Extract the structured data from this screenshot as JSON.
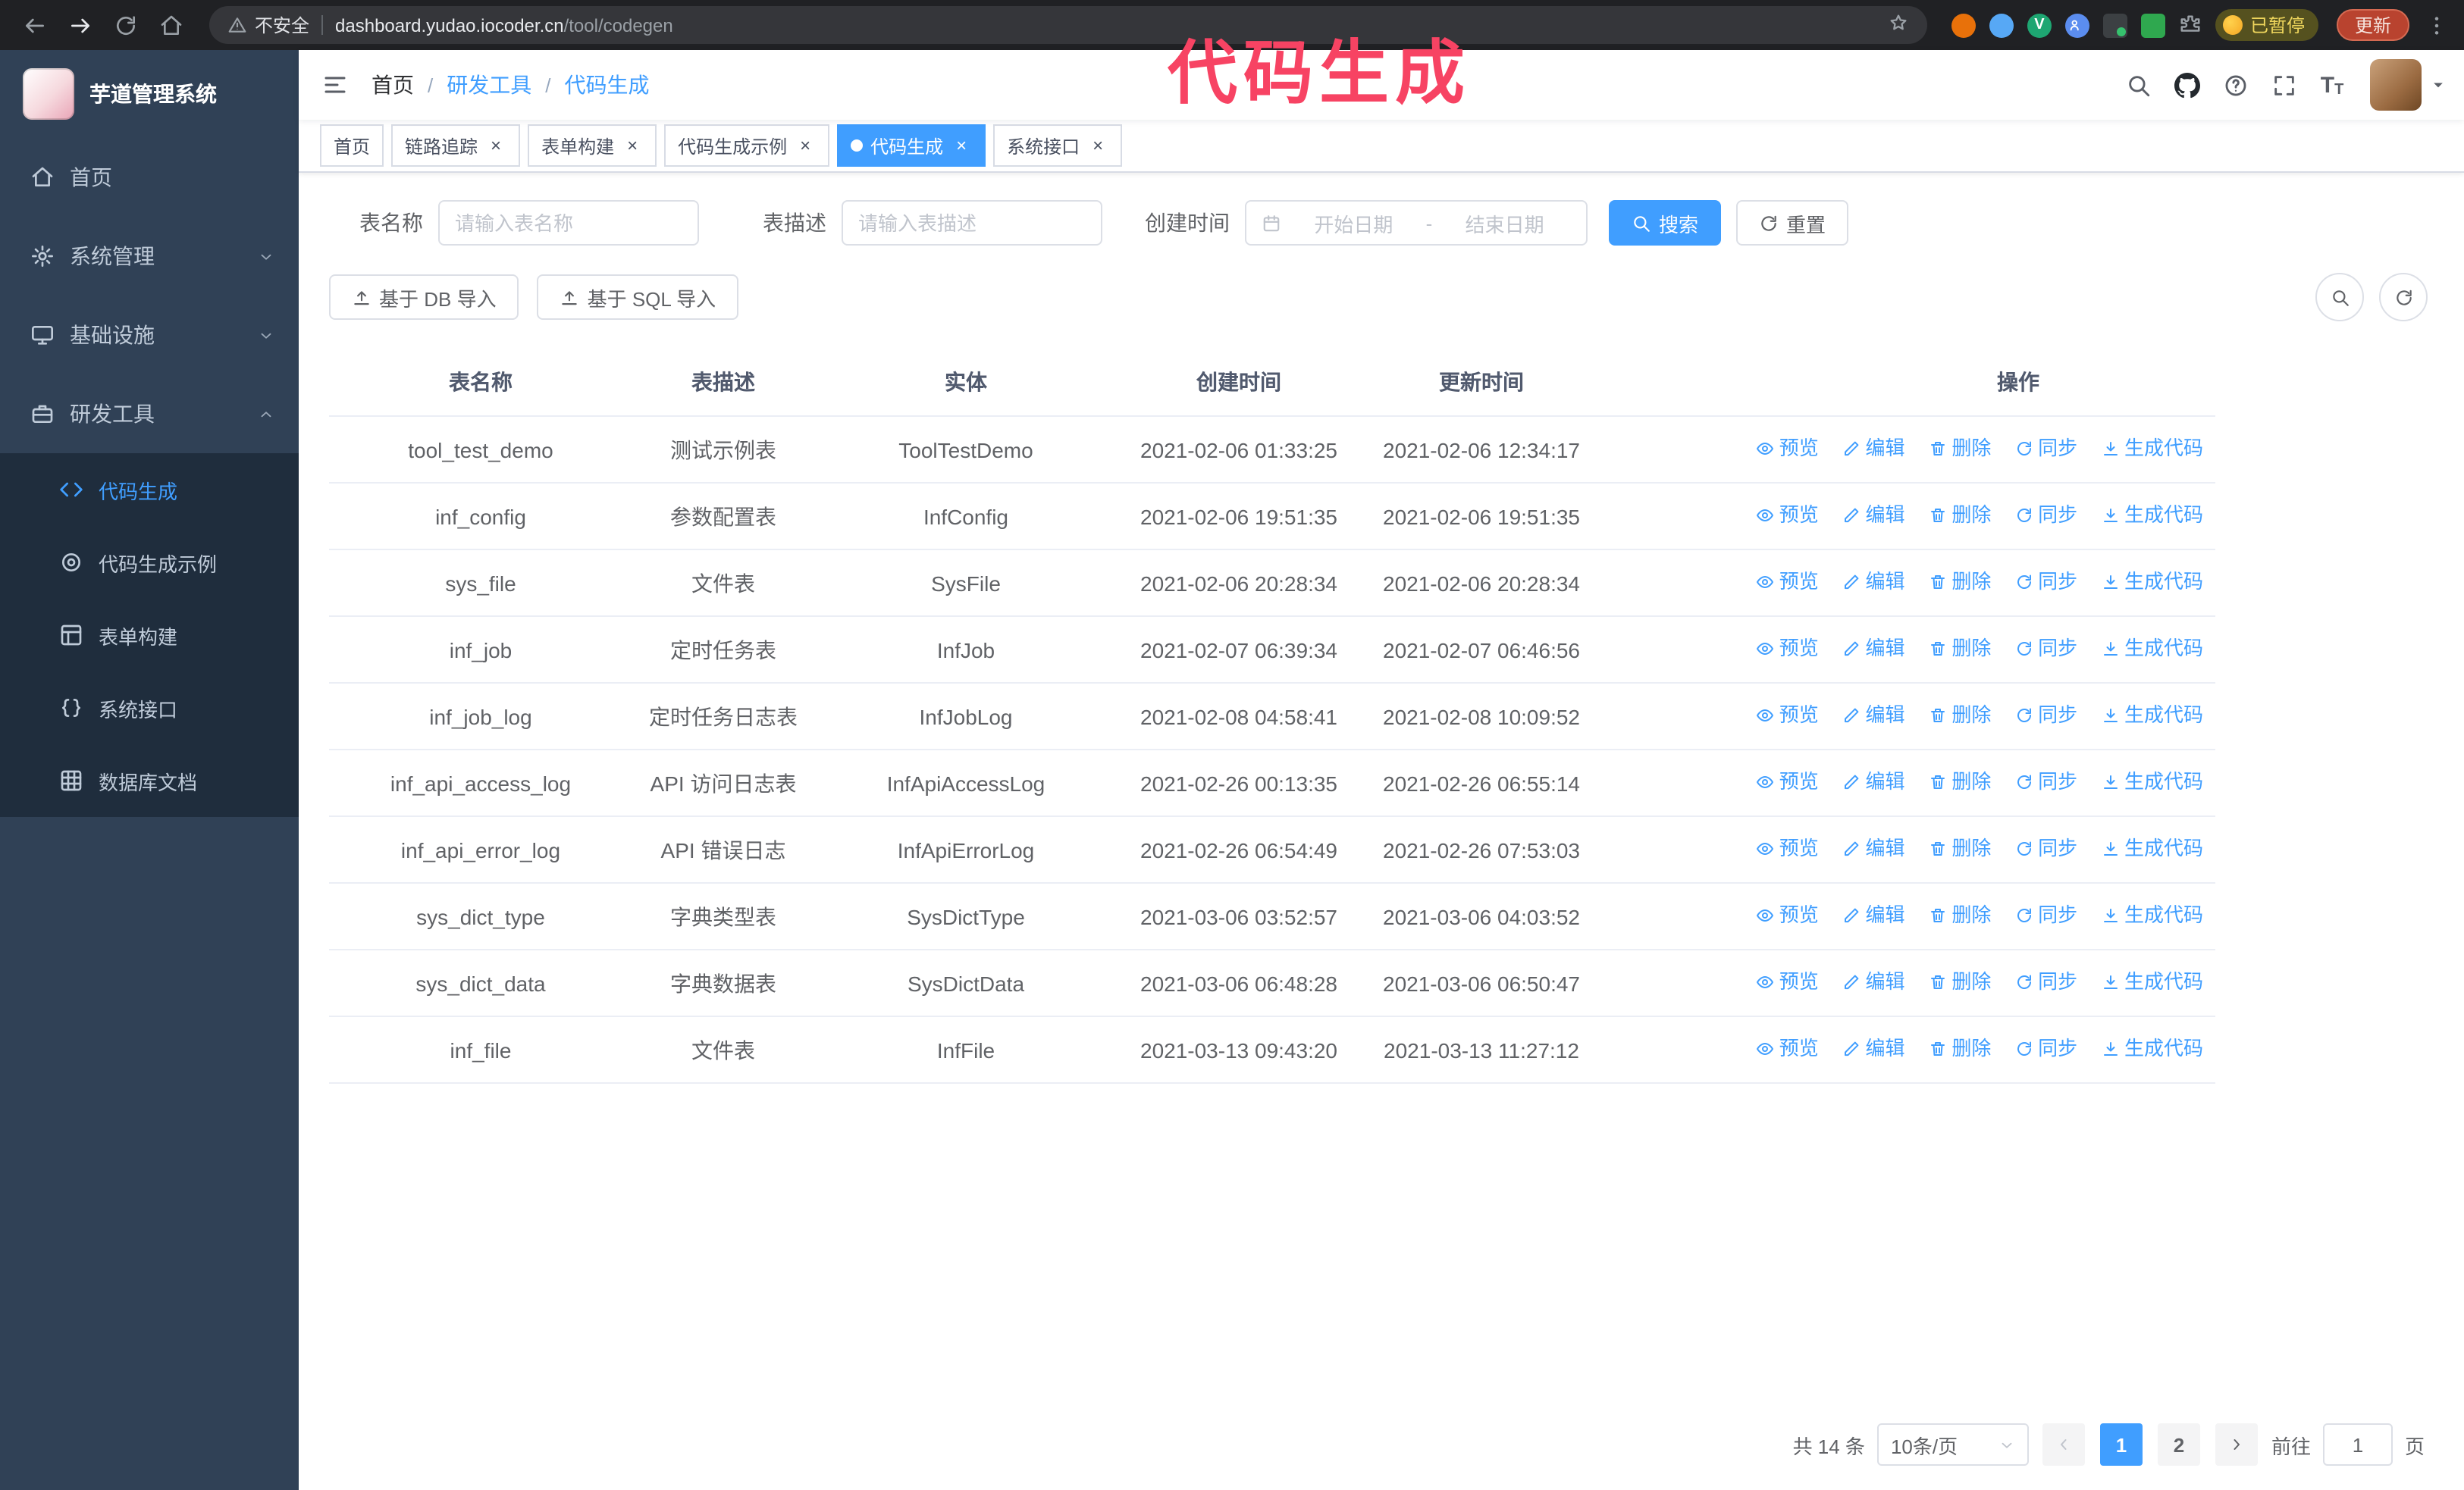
{
  "annotation": "代码生成",
  "browser": {
    "security_label": "不安全",
    "url_domain": "dashboard.yudao.iocoder.cn",
    "url_path": "/tool/codegen",
    "paused_badge": "已暂停",
    "update_button": "更新"
  },
  "sidebar": {
    "logo_title": "芋道管理系统",
    "items": [
      {
        "label": "首页"
      },
      {
        "label": "系统管理"
      },
      {
        "label": "基础设施"
      },
      {
        "label": "研发工具"
      }
    ],
    "sub_items": [
      {
        "label": "代码生成"
      },
      {
        "label": "代码生成示例"
      },
      {
        "label": "表单构建"
      },
      {
        "label": "系统接口"
      },
      {
        "label": "数据库文档"
      }
    ]
  },
  "header": {
    "breadcrumb": [
      "首页",
      "研发工具",
      "代码生成"
    ]
  },
  "tabs": [
    {
      "label": "首页"
    },
    {
      "label": "链路追踪"
    },
    {
      "label": "表单构建"
    },
    {
      "label": "代码生成示例"
    },
    {
      "label": "代码生成"
    },
    {
      "label": "系统接口"
    }
  ],
  "filters": {
    "table_name_label": "表名称",
    "table_name_placeholder": "请输入表名称",
    "table_desc_label": "表描述",
    "table_desc_placeholder": "请输入表描述",
    "create_time_label": "创建时间",
    "date_start_placeholder": "开始日期",
    "date_separator": "-",
    "date_end_placeholder": "结束日期",
    "search_button": "搜索",
    "reset_button": "重置"
  },
  "toolbar": {
    "import_db": "基于 DB 导入",
    "import_sql": "基于 SQL 导入"
  },
  "table": {
    "columns": [
      "表名称",
      "表描述",
      "实体",
      "创建时间",
      "更新时间",
      "操作"
    ],
    "actions": [
      "预览",
      "编辑",
      "删除",
      "同步",
      "生成代码"
    ],
    "rows": [
      {
        "name": "tool_test_demo",
        "desc": "测试示例表",
        "entity": "ToolTestDemo",
        "created": "2021-02-06 01:33:25",
        "updated": "2021-02-06 12:34:17"
      },
      {
        "name": "inf_config",
        "desc": "参数配置表",
        "entity": "InfConfig",
        "created": "2021-02-06 19:51:35",
        "updated": "2021-02-06 19:51:35"
      },
      {
        "name": "sys_file",
        "desc": "文件表",
        "entity": "SysFile",
        "created": "2021-02-06 20:28:34",
        "updated": "2021-02-06 20:28:34"
      },
      {
        "name": "inf_job",
        "desc": "定时任务表",
        "entity": "InfJob",
        "created": "2021-02-07 06:39:34",
        "updated": "2021-02-07 06:46:56"
      },
      {
        "name": "inf_job_log",
        "desc": "定时任务日志表",
        "entity": "InfJobLog",
        "created": "2021-02-08 04:58:41",
        "updated": "2021-02-08 10:09:52"
      },
      {
        "name": "inf_api_access_log",
        "desc": "API 访问日志表",
        "entity": "InfApiAccessLog",
        "created": "2021-02-26 00:13:35",
        "updated": "2021-02-26 06:55:14"
      },
      {
        "name": "inf_api_error_log",
        "desc": "API 错误日志",
        "entity": "InfApiErrorLog",
        "created": "2021-02-26 06:54:49",
        "updated": "2021-02-26 07:53:03"
      },
      {
        "name": "sys_dict_type",
        "desc": "字典类型表",
        "entity": "SysDictType",
        "created": "2021-03-06 03:52:57",
        "updated": "2021-03-06 04:03:52"
      },
      {
        "name": "sys_dict_data",
        "desc": "字典数据表",
        "entity": "SysDictData",
        "created": "2021-03-06 06:48:28",
        "updated": "2021-03-06 06:50:47"
      },
      {
        "name": "inf_file",
        "desc": "文件表",
        "entity": "InfFile",
        "created": "2021-03-13 09:43:20",
        "updated": "2021-03-13 11:27:12"
      }
    ]
  },
  "pagination": {
    "total": "共 14 条",
    "page_size": "10条/页",
    "pages": [
      "1",
      "2"
    ],
    "goto_label": "前往",
    "goto_value": "1",
    "goto_suffix": "页"
  },
  "icons": {
    "back-icon": "left-arrow",
    "forward-icon": "right-arrow",
    "reload-icon": "circular-arrow",
    "browser-home-icon": "house",
    "warning-icon": "triangle-exclamation",
    "star-icon": "star-outline",
    "extension-icons": "colored-circles + puzzle",
    "kebab-menu-icon": "vertical-dots",
    "search-icon": "magnifier",
    "github-icon": "octocat",
    "question-icon": "question-circle",
    "fullscreen-icon": "corner-brackets",
    "font-size-icon": "TT",
    "calendar-icon": "calendar",
    "upload-icon": "arrow-up-with-bar",
    "preview-icon": "eye",
    "edit-icon": "pencil",
    "delete-icon": "trash",
    "sync-icon": "refresh-arrows",
    "generate-code-icon": "download-arrow"
  }
}
